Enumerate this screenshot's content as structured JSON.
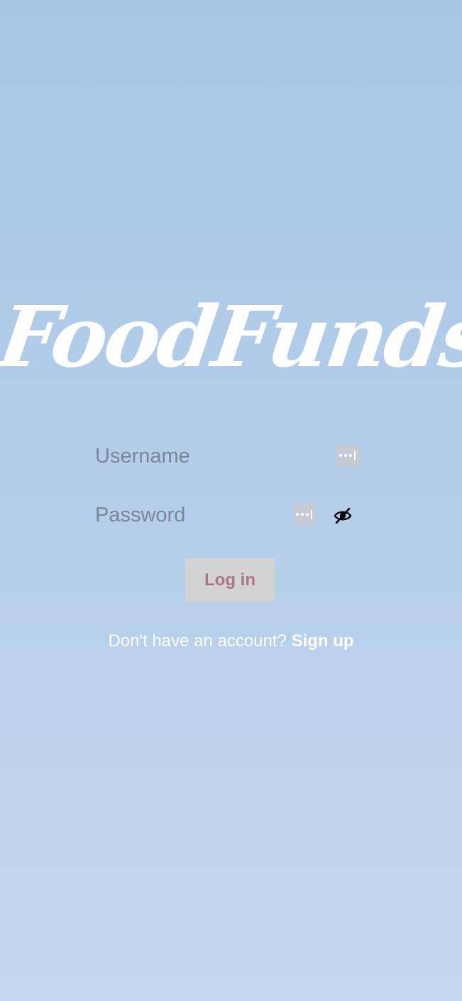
{
  "app": {
    "logo_text": "FoodFunds"
  },
  "login_form": {
    "username_placeholder": "Username",
    "password_placeholder": "Password",
    "login_label": "Log in"
  },
  "signup": {
    "prompt": "Don't have an account?",
    "link_label": "Sign up"
  },
  "icons": {
    "password_autofill_username": "password-key-icon",
    "password_autofill_password": "password-key-icon",
    "password_visibility": "eye-slash-icon"
  },
  "colors": {
    "background_top": "#a7c6e6",
    "background_bottom": "#c3d8ee",
    "placeholder": "#7a8799",
    "button_background": "#d3d3d3",
    "button_text": "#a87884",
    "text_light": "#ffffff"
  }
}
